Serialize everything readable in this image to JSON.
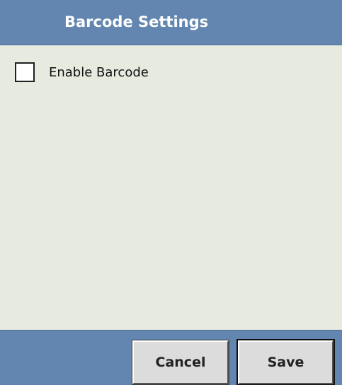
{
  "window": {
    "title": "Barcode Settings"
  },
  "settings": {
    "enable_barcode": {
      "label": "Enable Barcode",
      "checked": false
    }
  },
  "footer": {
    "cancel_label": "Cancel",
    "save_label": "Save"
  },
  "colors": {
    "title_bar": "#6286b0",
    "background": "#e6eadf",
    "button_face": "#dcdcdc"
  }
}
